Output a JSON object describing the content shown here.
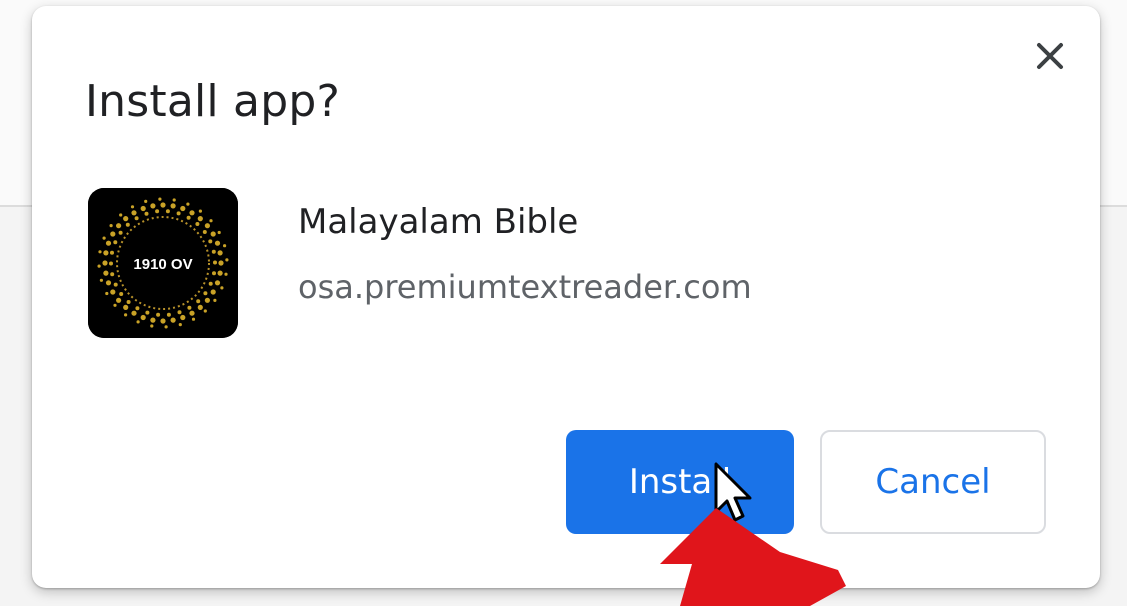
{
  "dialog": {
    "title": "Install app?",
    "close_icon": "close-icon",
    "app": {
      "icon_label": "1910 OV",
      "name": "Malayalam Bible",
      "origin": "osa.premiumtextreader.com"
    },
    "buttons": {
      "install_label": "Install",
      "cancel_label": "Cancel"
    }
  },
  "annotation": {
    "cursor_icon": "mouse-pointer-icon",
    "arrow_icon": "red-arrow-icon"
  },
  "colors": {
    "primary": "#1a73e8",
    "arrow": "#e0151b",
    "title_text": "#202124",
    "secondary_text": "#5f6368"
  }
}
